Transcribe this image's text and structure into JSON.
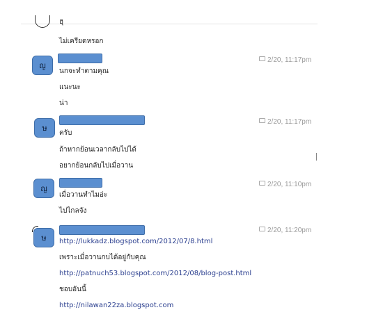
{
  "messages": [
    {
      "lines": [
        "ฮุ"
      ]
    },
    {
      "lines": [
        "ไม่เครียดหรอก"
      ]
    },
    {
      "avatar": "ญ",
      "timestamp": "2/20, 11:17pm",
      "lines": [
        "นกจะทำตามคุณ",
        "แนะนะ",
        "น่า"
      ]
    },
    {
      "avatar": "ษ",
      "timestamp": "2/20, 11:17pm",
      "lines": [
        "ครับ",
        "ถ้าหากย้อนเวลากลับไปได้",
        "อยากย้อนกลับไปเมื่อวาน"
      ]
    },
    {
      "avatar": "ญ",
      "timestamp": "2/20, 11:10pm",
      "lines": [
        "เมื่อวานทำไมอ่ะ",
        "ไปไกลจัง"
      ]
    },
    {
      "avatar": "ษ",
      "timestamp": "2/20, 11:20pm",
      "lines": [
        "http://lukkadz.blogspot.com/2012/07/8.html",
        "เพราะเมื่อวานกบได้อยู่กับคุณ",
        "http://patnuch53.blogspot.com/2012/08/blog-post.html",
        "ชอบอันนี้",
        "http://nilawan22za.blogspot.com"
      ]
    }
  ]
}
